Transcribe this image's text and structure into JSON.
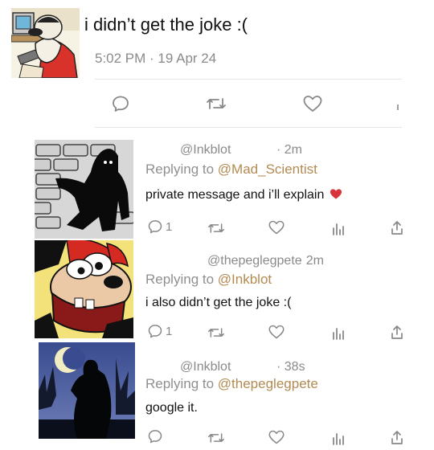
{
  "main_tweet": {
    "text": "i didn’t get the joke :(",
    "meta": "5:02 PM · 19 Apr 24"
  },
  "replies": [
    {
      "handle": "@Inkblot",
      "time": "· 2m",
      "replying_prefix": "Replying to",
      "replying_to": "@Mad_Scientist",
      "text": "private message and i’ll explain",
      "reply_count": "1"
    },
    {
      "handle": "@thepeglegpete",
      "time": "· 2m",
      "replying_prefix": "Replying to",
      "replying_to": "@Inkblot",
      "text": "i also didn’t get the joke :(",
      "reply_count": "1"
    },
    {
      "handle": "@Inkblot",
      "time": "· 38s",
      "replying_prefix": "Replying to",
      "replying_to": "@thepeglegpete",
      "text": "google it.",
      "reply_count": ""
    }
  ],
  "icons": {
    "reply": "reply-bubble-icon",
    "retweet": "retweet-icon",
    "like": "heart-icon",
    "analytics": "analytics-icon",
    "share": "share-icon",
    "emoji": "red-heart-emoji"
  },
  "colors": {
    "mention": "#b38a52",
    "heart_emoji": "#d8343b",
    "muted_text": "#8a8a8a",
    "icon_gray": "#888888"
  }
}
